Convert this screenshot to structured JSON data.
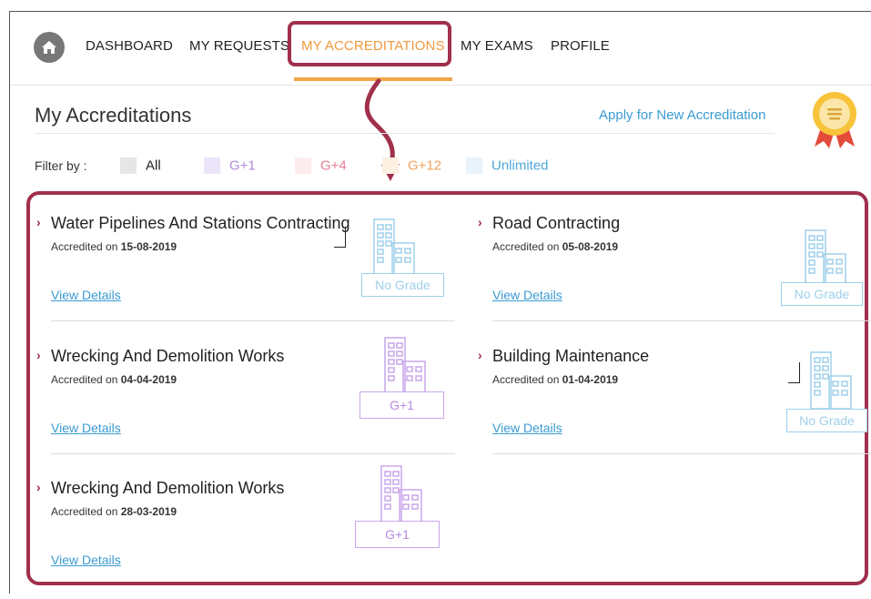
{
  "nav": {
    "items": [
      {
        "label": "DASHBOARD",
        "active": false
      },
      {
        "label": "MY REQUESTS",
        "active": false
      },
      {
        "label": "MY ACCREDITATIONS",
        "active": true
      },
      {
        "label": "MY EXAMS",
        "active": false
      },
      {
        "label": "PROFILE",
        "active": false
      }
    ]
  },
  "page": {
    "title": "My Accreditations",
    "apply_link": "Apply for New Accreditation"
  },
  "filters": {
    "label": "Filter by :",
    "options": [
      {
        "label": "All",
        "color": "#e6e6e6",
        "text_color": "#222222"
      },
      {
        "label": "G+1",
        "color": "#ece4f8",
        "text_color": "#b08ad8"
      },
      {
        "label": "G+4",
        "color": "#fdecee",
        "text_color": "#e57f93"
      },
      {
        "label": "G+12",
        "color": "#fdf0e2",
        "text_color": "#f0a15c"
      },
      {
        "label": "Unlimited",
        "color": "#e9f3fb",
        "text_color": "#4ea6d8"
      }
    ]
  },
  "accreditations": [
    {
      "title": "Water Pipelines And Stations Contracting",
      "date_prefix": "Accredited on ",
      "date": "15-08-2019",
      "link": "View Details",
      "grade": "No Grade",
      "grade_color": "#9fd0ea"
    },
    {
      "title": "Road Contracting",
      "date_prefix": "Accredited on ",
      "date": "05-08-2019",
      "link": "View Details",
      "grade": "No Grade",
      "grade_color": "#9fd0ea"
    },
    {
      "title": "Wrecking And Demolition Works",
      "date_prefix": "Accredited on ",
      "date": "04-04-2019",
      "link": "View Details",
      "grade": "G+1",
      "grade_color": "#c9a6ec"
    },
    {
      "title": "Building Maintenance",
      "date_prefix": "Accredited on ",
      "date": "01-04-2019",
      "link": "View Details",
      "grade": "No Grade",
      "grade_color": "#9fd0ea"
    },
    {
      "title": "Wrecking And Demolition Works",
      "date_prefix": "Accredited on ",
      "date": "28-03-2019",
      "link": "View Details",
      "grade": "G+1",
      "grade_color": "#c9a6ec"
    }
  ],
  "colors": {
    "accent_orange": "#f09a3e",
    "highlight": "#a0304c",
    "link_blue": "#3b9bd4"
  }
}
